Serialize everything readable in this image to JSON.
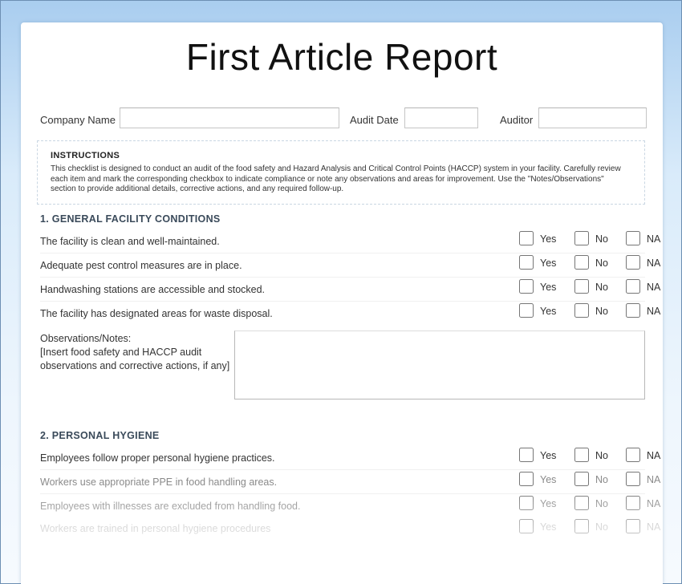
{
  "title": "First Article Report",
  "header_fields": {
    "company_label": "Company Name",
    "company_value": "",
    "date_label": "Audit Date",
    "date_value": "",
    "auditor_label": "Auditor",
    "auditor_value": ""
  },
  "instructions": {
    "heading": "INSTRUCTIONS",
    "text": "This checklist is designed to conduct an audit of the food safety and Hazard Analysis and Critical Control Points (HACCP) system in your facility. Carefully review each item and mark the corresponding checkbox to indicate compliance or note any observations and areas for improvement. Use the \"Notes/Observations\" section to provide additional details, corrective actions, and any required follow-up."
  },
  "options": {
    "yes": "Yes",
    "no": "No",
    "na": "NA"
  },
  "sections": [
    {
      "title": "1. GENERAL FACILITY CONDITIONS",
      "items": [
        "The facility is clean and well-maintained.",
        "Adequate pest control measures are in place.",
        "Handwashing stations are accessible and stocked.",
        "The facility has designated areas for waste disposal."
      ],
      "notes_label": "Observations/Notes:",
      "notes_placeholder": "[Insert food safety and HACCP audit observations and corrective actions, if any]"
    },
    {
      "title": "2. PERSONAL HYGIENE",
      "items": [
        "Employees follow proper personal hygiene practices.",
        "Workers use appropriate PPE in food handling areas.",
        "Employees with illnesses are excluded from handling food.",
        "Workers are trained in personal hygiene procedures"
      ]
    }
  ]
}
